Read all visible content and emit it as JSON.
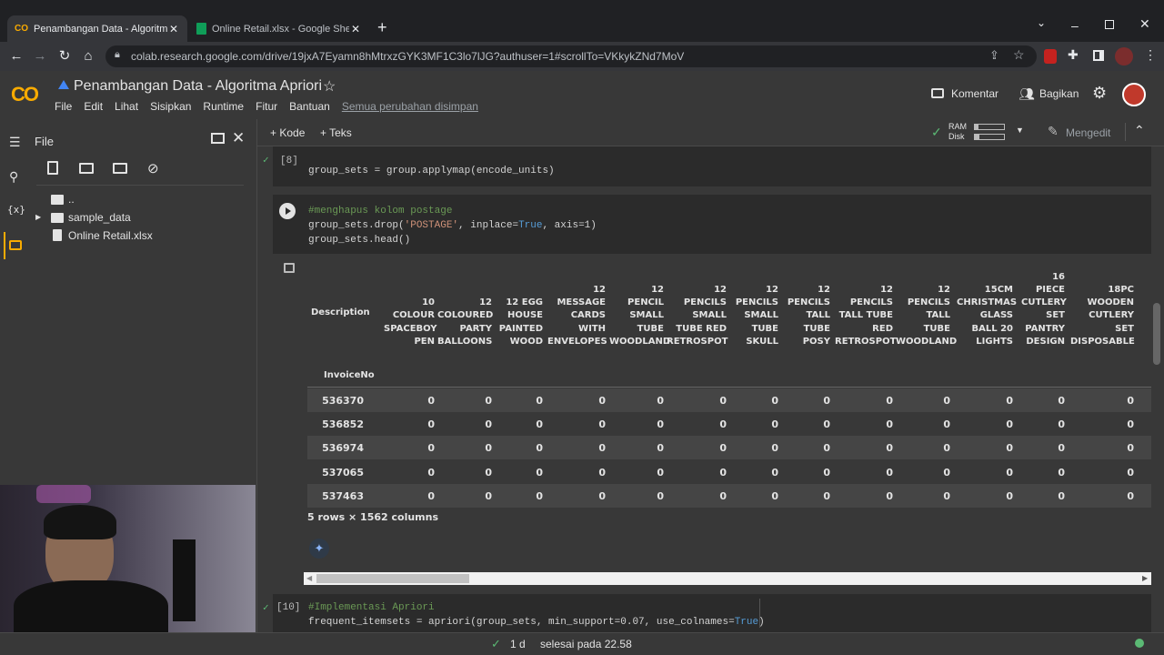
{
  "browser": {
    "tabs": [
      {
        "title": "Penambangan Data - Algoritma A",
        "active": true
      },
      {
        "title": "Online Retail.xlsx - Google Sheets",
        "active": false
      }
    ],
    "url": "colab.research.google.com/drive/19jxA7Eyamn8hMtrxzGYK3MF1C3lo7lJG?authuser=1#scrollTo=VKkykZNd7MoV"
  },
  "colab": {
    "logo": "CO",
    "title": "Penambangan Data - Algoritma Apriori",
    "menu": [
      "File",
      "Edit",
      "Lihat",
      "Sisipkan",
      "Runtime",
      "Fitur",
      "Bantuan"
    ],
    "saved_status": "Semua perubahan disimpan",
    "comment_label": "Komentar",
    "share_label": "Bagikan"
  },
  "toolbar": {
    "add_code": "+ Kode",
    "add_text": "+ Teks",
    "ram_label": "RAM",
    "disk_label": "Disk",
    "edit_mode": "Mengedit"
  },
  "sidebar": {
    "title": "File",
    "files": [
      {
        "name": "..",
        "type": "folder-up"
      },
      {
        "name": "sample_data",
        "type": "folder"
      },
      {
        "name": "Online Retail.xlsx",
        "type": "file"
      }
    ]
  },
  "cells": {
    "c8_label": "[8]",
    "c8_code": "group_sets = group.applymap(encode_units)",
    "c9_comment": "#menghapus kolom postage",
    "c9_l2a": "group_sets.drop(",
    "c9_l2b": "'POSTAGE'",
    "c9_l2c": ", inplace=",
    "c9_l2d": "True",
    "c9_l2e": ", axis=1)",
    "c9_l3": "group_sets.head()",
    "c10_label": "[10]",
    "c10_comment": "#Implementasi Apriori",
    "c10_l2a": "frequent_itemsets = apriori(group_sets, min_support=0.07, use_colnames=",
    "c10_l2b": "True",
    "c10_l2c": ")"
  },
  "dataframe": {
    "index_header": "Description",
    "index_name": "InvoiceNo",
    "columns": [
      "10 COLOUR SPACEBOY PEN",
      "12 COLOURED PARTY BALLOONS",
      "12 EGG HOUSE PAINTED WOOD",
      "12 MESSAGE CARDS WITH ENVELOPES",
      "12 PENCIL SMALL TUBE WOODLAND",
      "12 PENCILS SMALL TUBE RED RETROSPOT",
      "12 PENCILS SMALL TUBE SKULL",
      "12 PENCILS TALL TUBE POSY",
      "12 PENCILS TALL TUBE RED RETROSPOT",
      "12 PENCILS TALL TUBE WOODLAND",
      "15CM CHRISTMAS GLASS BALL 20 LIGHTS",
      "16 PIECE CUTLERY SET PANTRY DESIGN",
      "18PC WOODEN CUTLERY SET DISPOSABLE"
    ],
    "rows": [
      {
        "index": "536370",
        "values": [
          0,
          0,
          0,
          0,
          0,
          0,
          0,
          0,
          0,
          0,
          0,
          0,
          0
        ]
      },
      {
        "index": "536852",
        "values": [
          0,
          0,
          0,
          0,
          0,
          0,
          0,
          0,
          0,
          0,
          0,
          0,
          0
        ]
      },
      {
        "index": "536974",
        "values": [
          0,
          0,
          0,
          0,
          0,
          0,
          0,
          0,
          0,
          0,
          0,
          0,
          0
        ]
      },
      {
        "index": "537065",
        "values": [
          0,
          0,
          0,
          0,
          0,
          0,
          0,
          0,
          0,
          0,
          0,
          0,
          0
        ]
      },
      {
        "index": "537463",
        "values": [
          0,
          0,
          0,
          0,
          0,
          0,
          0,
          0,
          0,
          0,
          0,
          0,
          0
        ]
      }
    ],
    "shape_text": "5 rows × 1562 columns"
  },
  "status": {
    "check_duration": "1 d",
    "completed_text": "selesai pada 22.58"
  }
}
